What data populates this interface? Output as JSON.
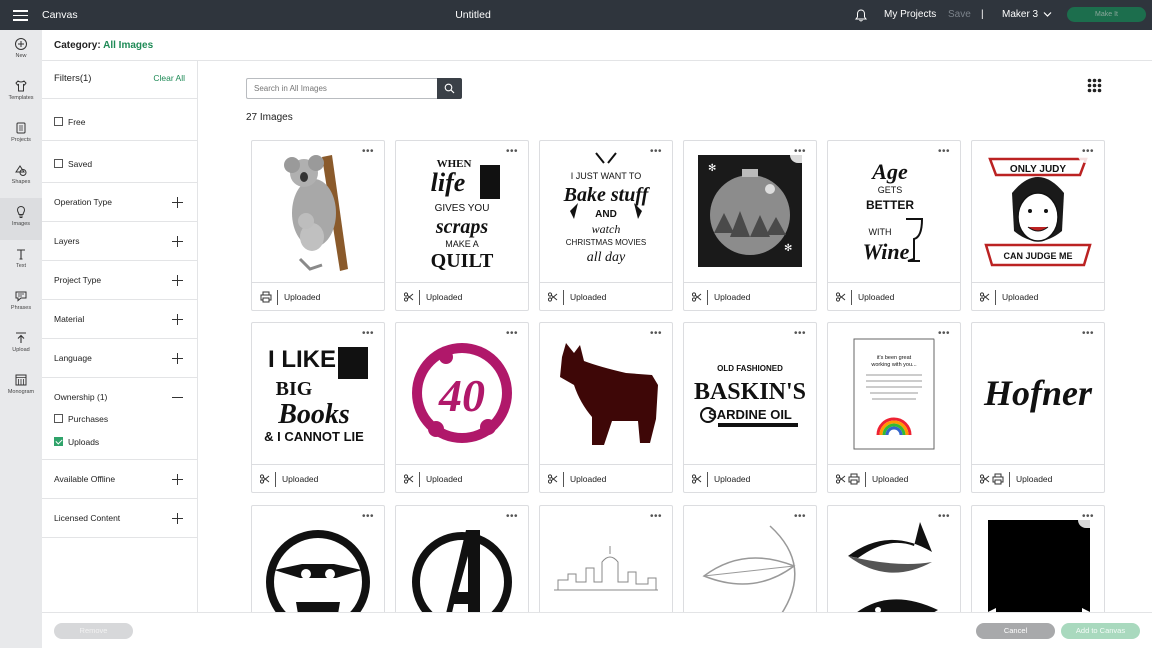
{
  "topbar": {
    "app_name": "Canvas",
    "doc_title": "Untitled",
    "my_projects": "My Projects",
    "save": "Save",
    "separator": "|",
    "machine": "Maker 3",
    "make_it": "Make It"
  },
  "rail": {
    "items": [
      {
        "label": "New",
        "icon": "plus-circle-icon"
      },
      {
        "label": "Templates",
        "icon": "shirt-icon"
      },
      {
        "label": "Projects",
        "icon": "projects-icon"
      },
      {
        "label": "Shapes",
        "icon": "shapes-icon"
      },
      {
        "label": "Images",
        "icon": "lightbulb-icon"
      },
      {
        "label": "Text",
        "icon": "text-icon"
      },
      {
        "label": "Phrases",
        "icon": "speech-bubble-icon"
      },
      {
        "label": "Upload",
        "icon": "upload-icon"
      },
      {
        "label": "Monogram",
        "icon": "monogram-icon"
      }
    ]
  },
  "category": {
    "label": "Category:",
    "value": "All Images"
  },
  "filters": {
    "title": "Filters(1)",
    "clear_all": "Clear All",
    "free": "Free",
    "saved": "Saved",
    "operation_type": "Operation Type",
    "layers": "Layers",
    "project_type": "Project Type",
    "material": "Material",
    "language": "Language",
    "ownership": "Ownership (1)",
    "purchases": "Purchases",
    "uploads": "Uploads",
    "available_offline": "Available Offline",
    "licensed_content": "Licensed Content"
  },
  "search": {
    "placeholder": "Search in All Images"
  },
  "results": {
    "count_label": "27 Images"
  },
  "cards": [
    {
      "status": "Uploaded",
      "art": "koala"
    },
    {
      "status": "Uploaded",
      "art": "When life gives you scraps make a quilt"
    },
    {
      "status": "Uploaded",
      "art": "I just want to bake stuff and watch Christmas movies all day"
    },
    {
      "status": "Uploaded",
      "art": "ornament"
    },
    {
      "status": "Uploaded",
      "art": "Age gets better with wine"
    },
    {
      "status": "Uploaded",
      "art": "Only Judy can judge me"
    },
    {
      "status": "Uploaded",
      "art": "I like big books & I cannot lie"
    },
    {
      "status": "Uploaded",
      "art": "40"
    },
    {
      "status": "Uploaded",
      "art": "terrier"
    },
    {
      "status": "Uploaded",
      "art": "Old fashioned Baskin's Sardine Oil"
    },
    {
      "status": "Uploaded",
      "art": "It's been great working with you..."
    },
    {
      "status": "Uploaded",
      "art": "Hofner"
    },
    {
      "status": "",
      "art": "baby yoda"
    },
    {
      "status": "",
      "art": "avengers"
    },
    {
      "status": "",
      "art": "city skyline"
    },
    {
      "status": "",
      "art": "feather"
    },
    {
      "status": "",
      "art": "orcas"
    },
    {
      "status": "",
      "art": "black banner"
    }
  ],
  "bottom": {
    "remove": "Remove",
    "cancel": "Cancel",
    "add_to_canvas": "Add to Canvas"
  },
  "colors": {
    "topbar": "#2f353d",
    "accent": "#1e8a56",
    "make_it": "#1c6e4d"
  }
}
